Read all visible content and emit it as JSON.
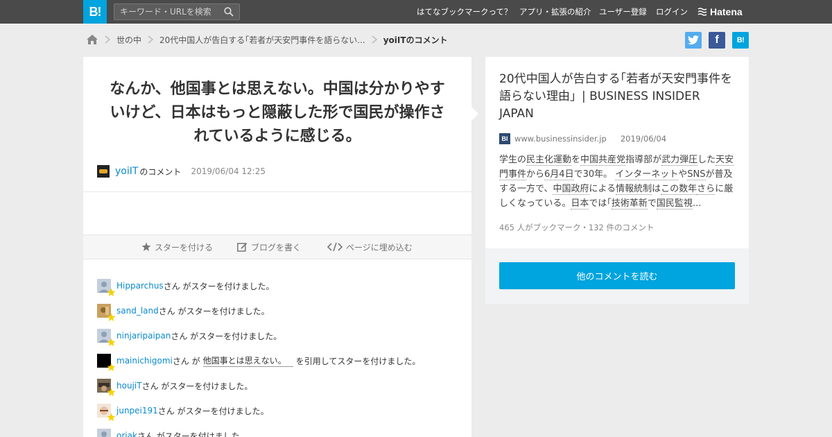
{
  "header": {
    "logo": "B!",
    "search_placeholder": "キーワード・URLを検索",
    "nav": [
      "はてなブックマークって？",
      "アプリ・拡張の紹介",
      "ユーザー登録",
      "ログイン"
    ],
    "brand": "Hatena"
  },
  "breadcrumb": {
    "items": [
      "世の中",
      "20代中国人が告白する｢若者が天安門事件を語らない...",
      "yoiITのコメント"
    ]
  },
  "social": {
    "facebook": "f",
    "hatena": "B!"
  },
  "comment": {
    "text": "なんか、他国事とは思えない。中国は分かりやすいけど、日本はもっと隠蔽した形で国民が操作されているように感じる。",
    "author": "yoiIT",
    "author_suffix": "のコメント",
    "timestamp": "2019/06/04 12:25"
  },
  "actions": {
    "star": "スターを付ける",
    "blog": "ブログを書く",
    "embed": "ページに埋め込む"
  },
  "stars": [
    {
      "user": "Hipparchus",
      "text": "さん がスターを付けました。"
    },
    {
      "user": "sand_land",
      "text": "さん がスターを付けました。"
    },
    {
      "user": "ninjaripaipan",
      "text": "さん がスターを付けました。"
    },
    {
      "user": "mainichigomi",
      "pre": "さん が",
      "quote": "他国事とは思えない。",
      "text": "を引用してスターを付けました。"
    },
    {
      "user": "houjiT",
      "text": "さん がスターを付けました。"
    },
    {
      "user": "junpei191",
      "text": "さん がスターを付けました。"
    },
    {
      "user": "oriak",
      "text": "さん がスターを付けました。"
    }
  ],
  "entry": {
    "title": "20代中国人が告白する｢若者が天安門事件を語らない理由」| BUSINESS INSIDER JAPAN",
    "favicon": "BI",
    "domain": "www.businessinsider.jp",
    "date": "2019/06/04",
    "summary_parts": [
      "学生の",
      "民主化運動",
      "を",
      "中国共産党",
      "指導部が",
      "武力弾圧",
      "した",
      "天安門事件",
      "から",
      "6月4日",
      "で30年。 ",
      "インターネット",
      "や",
      "SNS",
      "が普及する一方で、",
      "中国政府",
      "による",
      "情報統制",
      "は",
      "この数年",
      "さら",
      "に厳しくなっている。",
      "日本",
      "では｢",
      "技術革新",
      "で",
      "国民監視",
      "..."
    ],
    "stats": "465 人がブックマーク・132 件のコメント"
  },
  "more_button": "他のコメントを読む"
}
